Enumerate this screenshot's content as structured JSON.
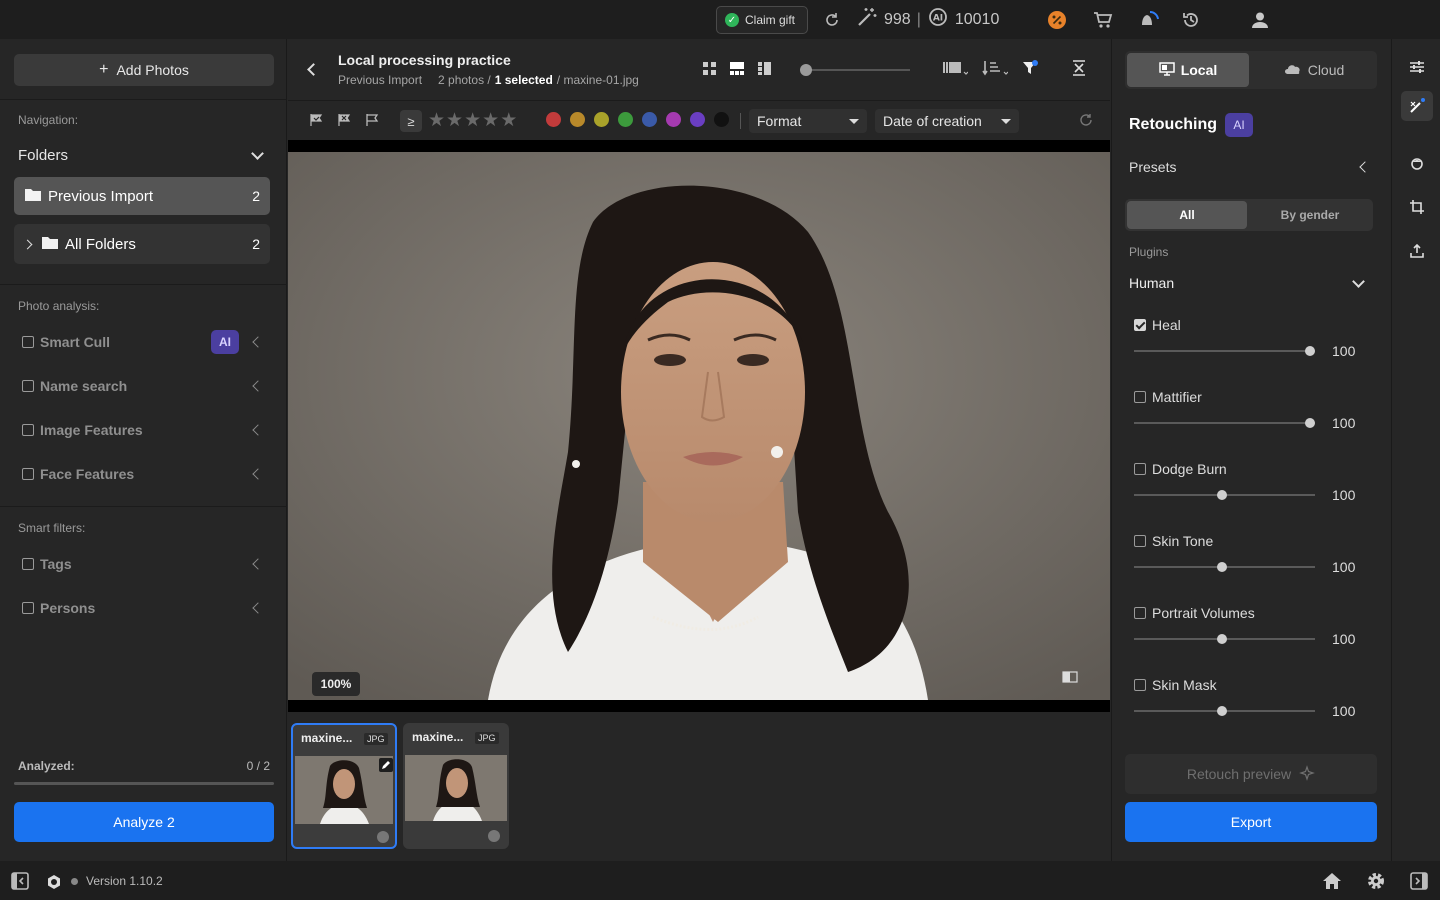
{
  "topbar": {
    "claim_gift": "Claim gift",
    "credits": "998",
    "separator": "|",
    "ai_credits": "10010"
  },
  "left": {
    "add_photos": "Add Photos",
    "navigation_label": "Navigation:",
    "folders_label": "Folders",
    "previous_import": {
      "label": "Previous Import",
      "count": "2"
    },
    "all_folders": {
      "label": "All Folders",
      "count": "2"
    },
    "photo_analysis_label": "Photo analysis:",
    "analysis_items": [
      {
        "label": "Smart Cull",
        "badge": "AI"
      },
      {
        "label": "Name search"
      },
      {
        "label": "Image Features"
      },
      {
        "label": "Face Features"
      }
    ],
    "smart_filters_label": "Smart filters:",
    "smart_filters": [
      {
        "label": "Tags"
      },
      {
        "label": "Persons"
      }
    ],
    "analyzed_label": "Analyzed:",
    "analyzed_value": "0 / 2",
    "analyze_button": "Analyze 2"
  },
  "header": {
    "title": "Local processing practice",
    "folder": "Previous Import",
    "photos_count": "2 photos /",
    "selected": "1 selected",
    "filename": "/ maxine-01.jpg"
  },
  "filters": {
    "gte": "≥",
    "format": "Format",
    "date": "Date of creation",
    "colors": [
      "#c23b3b",
      "#b8892a",
      "#a9a22a",
      "#3c9a3c",
      "#3a5aa8",
      "#a53ab0",
      "#6a3ec2",
      "#111111"
    ]
  },
  "viewer": {
    "zoom": "100%"
  },
  "thumbnails": [
    {
      "name": "maxine...",
      "type": "JPG"
    },
    {
      "name": "maxine...",
      "type": "JPG"
    }
  ],
  "right": {
    "local_tab": "Local",
    "cloud_tab": "Cloud",
    "section_title": "Retouching",
    "ai_badge": "AI",
    "presets_label": "Presets",
    "all_tab": "All",
    "by_gender_tab": "By gender",
    "plugins_label": "Plugins",
    "plugin_group": "Human",
    "plugins": [
      {
        "label": "Heal",
        "value": "100",
        "checked": true,
        "level": 1.0
      },
      {
        "label": "Mattifier",
        "value": "100",
        "checked": false,
        "level": 1.0
      },
      {
        "label": "Dodge Burn",
        "value": "100",
        "checked": false,
        "level": 0.5
      },
      {
        "label": "Skin Tone",
        "value": "100",
        "checked": false,
        "level": 0.5
      },
      {
        "label": "Portrait Volumes",
        "value": "100",
        "checked": false,
        "level": 0.5
      },
      {
        "label": "Skin Mask",
        "value": "100",
        "checked": false,
        "level": 0.5
      }
    ],
    "retouch_preview": "Retouch preview",
    "export": "Export"
  },
  "bottom": {
    "version": "Version 1.10.2"
  }
}
